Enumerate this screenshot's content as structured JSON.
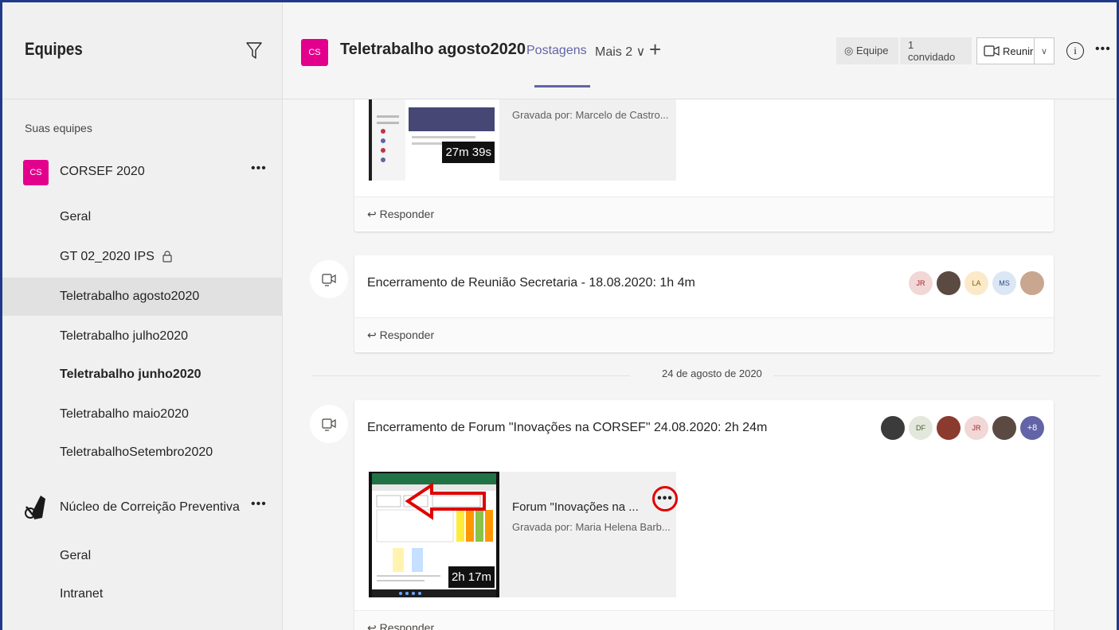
{
  "sidebar": {
    "title": "Equipes",
    "section_label": "Suas equipes",
    "teams": [
      {
        "avatar_text": "CS",
        "name": "CORSEF 2020",
        "more": "•••",
        "channels": [
          {
            "label": "Geral"
          },
          {
            "label": "GT 02_2020 IPS"
          },
          {
            "label": "Teletrabalho agosto2020"
          },
          {
            "label": "Teletrabalho julho2020"
          },
          {
            "label": "Teletrabalho junho2020"
          },
          {
            "label": "Teletrabalho maio2020"
          },
          {
            "label": "TeletrabalhoSetembro2020"
          }
        ]
      },
      {
        "name": "Núcleo de Correição Preventiva",
        "more": "•••",
        "channels": [
          {
            "label": "Geral"
          },
          {
            "label": "Intranet"
          }
        ]
      }
    ]
  },
  "header": {
    "avatar_text": "CS",
    "channel_title": "Teletrabalho agosto2020",
    "tab_posts": "Postagens",
    "tab_more": "Mais 2 ∨",
    "add_tab": "+",
    "team_pill": "◎ Equipe",
    "guest_pill": "1 convidado",
    "meet_label": "Reunir",
    "meet_caret": "∨",
    "info": "i",
    "more": "•••"
  },
  "feed": {
    "reply_label": "↩ Responder",
    "post1": {
      "recorded_by": "Gravada por: Marcelo de Castro...",
      "duration": "27m 39s"
    },
    "post2": {
      "title": "Encerramento de Reunião Secretaria - 18.08.2020: 1h 4m",
      "avatars": [
        "JR",
        "",
        "LA",
        "MS",
        ""
      ]
    },
    "date_separator": "24 de agosto de 2020",
    "post3": {
      "title": "Encerramento de Forum \"Inovações na CORSEF\" 24.08.2020: 2h 24m",
      "avatars": [
        "",
        "DF",
        "",
        "JR",
        "",
        "+8"
      ],
      "recording_title": "Forum \"Inovações na ...",
      "recorded_by": "Gravada por: Maria Helena Barb...",
      "duration": "2h 17m",
      "more": "•••"
    }
  },
  "colors": {
    "brand_purple": "#6264a7",
    "team_magenta": "#e3008c",
    "annotation_red": "#e00000"
  }
}
